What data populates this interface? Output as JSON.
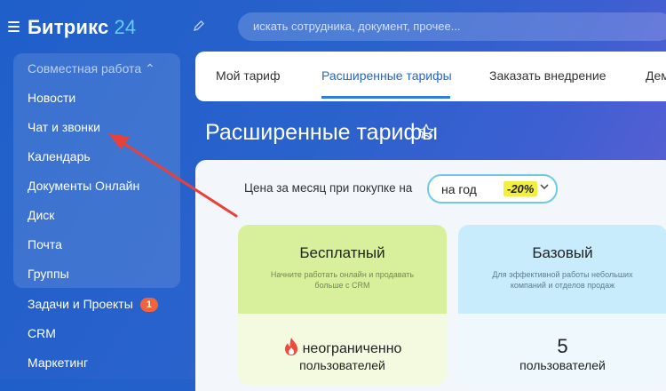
{
  "header": {
    "logo_text": "Битрикс",
    "logo_num": "24",
    "search_placeholder": "искать сотрудника, документ, прочее..."
  },
  "sidebar": {
    "group_title": "Совместная работа ⌃",
    "items": [
      {
        "label": "Новости"
      },
      {
        "label": "Чат и звонки"
      },
      {
        "label": "Календарь"
      },
      {
        "label": "Документы Онлайн"
      },
      {
        "label": "Диск"
      },
      {
        "label": "Почта"
      },
      {
        "label": "Группы"
      },
      {
        "label": "Задачи и Проекты",
        "badge": "1"
      },
      {
        "label": "CRM"
      },
      {
        "label": "Маркетинг"
      }
    ]
  },
  "tabs": [
    {
      "label": "Мой тариф"
    },
    {
      "label": "Расширенные тарифы"
    },
    {
      "label": "Заказать внедрение"
    },
    {
      "label": "Дем"
    }
  ],
  "page_title": "Расширенные тарифы",
  "pricing": {
    "price_label": "Цена за месяц при покупке на",
    "period": "на год",
    "discount": "-20%"
  },
  "plans": [
    {
      "name": "Бесплатный",
      "description": "Начните работать онлайн и продавать больше с CRM",
      "users_main": "неограниченно",
      "users_sub": "пользователей"
    },
    {
      "name": "Базовый",
      "description": "Для эффективной работы небольших компаний и отделов продаж",
      "users_main": "5",
      "users_sub": "пользователей"
    }
  ],
  "colors": {
    "accent": "#2f7de1",
    "annotation_arrow": "#e8413a",
    "badge": "#f0633c",
    "discount_highlight": "#f4ee3c"
  },
  "icons": [
    "menu-icon",
    "pencil-icon",
    "star-icon",
    "chevron-down-icon",
    "fire-icon",
    "annotation-arrow"
  ]
}
